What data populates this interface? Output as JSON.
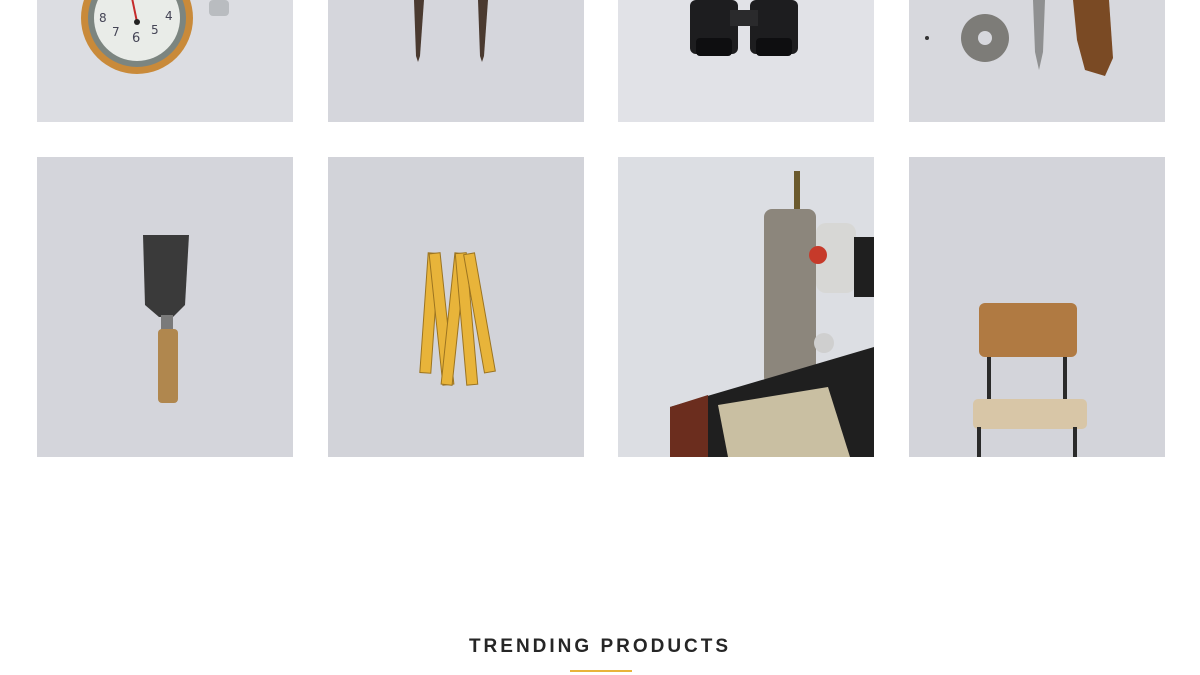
{
  "gallery": {
    "items": [
      {
        "subject": "wall-clock-icon"
      },
      {
        "subject": "pencils-icon"
      },
      {
        "subject": "binoculars-icon"
      },
      {
        "subject": "washer-and-knives-icon"
      },
      {
        "subject": "putty-knife-icon"
      },
      {
        "subject": "folding-ruler-icon"
      },
      {
        "subject": "sewing-machine-icon"
      },
      {
        "subject": "wooden-chair-icon"
      }
    ]
  },
  "section": {
    "title": "TRENDING PRODUCTS"
  },
  "colors": {
    "accent": "#e8b43a",
    "heading": "#262626",
    "tile_bg": "#d9dbe0"
  }
}
